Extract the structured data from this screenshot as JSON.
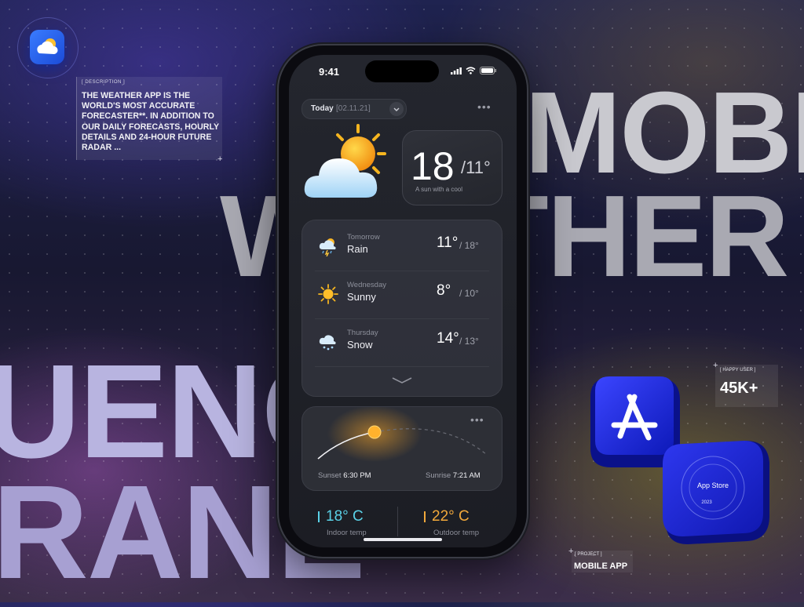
{
  "background_text": {
    "line1": "MOBI",
    "line2": "WEATHER",
    "line3": "UENC",
    "line4": "RANE"
  },
  "description": {
    "tag": "[ DESCRIPTION ]",
    "text": "THE WEATHER APP IS THE WORLD'S MOST ACCURATE FORECASTER**. IN ADDITION TO OUR DAILY FORECASTS, HOURLY DETAILS AND 24-HOUR FUTURE RADAR ..."
  },
  "happy_user": {
    "tag": "[ HAPPY USER ]",
    "value": "45K+"
  },
  "project": {
    "tag": "[ PROJECT ]",
    "value": "MOBILE APP"
  },
  "app_store": {
    "label": "App Store",
    "year": "2023"
  },
  "phone": {
    "status": {
      "time": "9:41"
    },
    "header": {
      "today_label": "Today",
      "date": "[02.11.21]"
    },
    "current": {
      "temp": "18",
      "low": "/11°",
      "caption": "A sun with a cool"
    },
    "forecast": [
      {
        "day": "Tomorrow",
        "condition": "Rain",
        "icon": "rain-cloud-icon",
        "high": "11°",
        "low": "/ 18°"
      },
      {
        "day": "Wednesday",
        "condition": "Sunny",
        "icon": "sun-icon",
        "high": "8°",
        "low": "/ 10°"
      },
      {
        "day": "Thursday",
        "condition": "Snow",
        "icon": "snow-cloud-icon",
        "high": "14°",
        "low": "/ 13°"
      }
    ],
    "sun": {
      "sunset_label": "Sunset",
      "sunset_time": "6:30 PM",
      "sunrise_label": "Sunrise",
      "sunrise_time": "7:21 AM"
    },
    "temps": {
      "indoor_value": "18° C",
      "indoor_label": "Indoor temp",
      "outdoor_value": "22° C",
      "outdoor_label": "Outdoor temp"
    }
  },
  "colors": {
    "indoor": "#5ad2e8",
    "outdoor": "#f2a93b",
    "accent": "#2c5cff"
  }
}
